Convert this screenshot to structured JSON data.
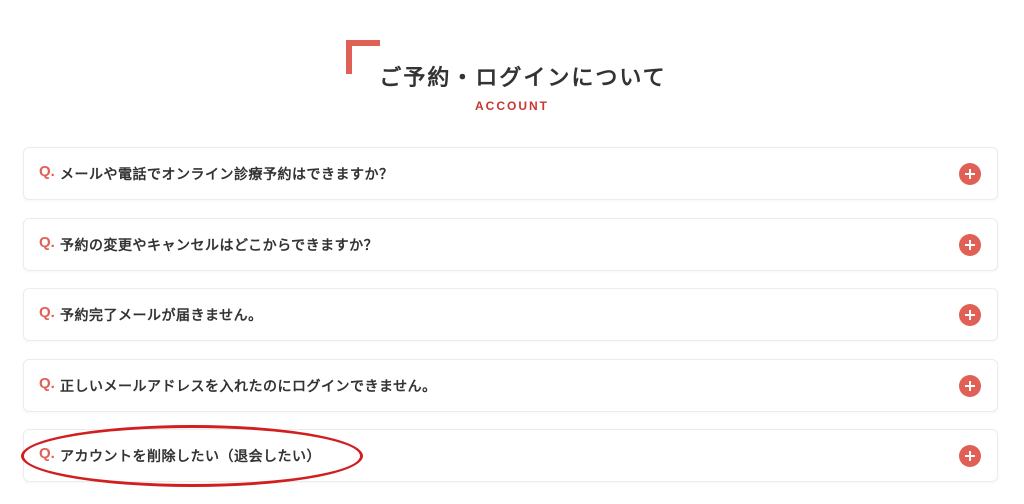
{
  "section": {
    "title": "ご予約・ログインについて",
    "subtitle": "ACCOUNT"
  },
  "colors": {
    "accent": "#e06055",
    "subtitle": "#c8372d",
    "highlight": "#d11f1f",
    "text": "#333333",
    "border": "#ececec"
  },
  "faq": {
    "q_prefix": "Q.",
    "expand_icon": "plus-circle-icon",
    "items": [
      {
        "question": "メールや電話でオンライン診療予約はできますか？"
      },
      {
        "question": "予約の変更やキャンセルはどこからできますか？"
      },
      {
        "question": "予約完了メールが届きません。"
      },
      {
        "question": "正しいメールアドレスを入れたのにログインできません。"
      },
      {
        "question": "アカウントを削除したい（退会したい）"
      }
    ]
  }
}
